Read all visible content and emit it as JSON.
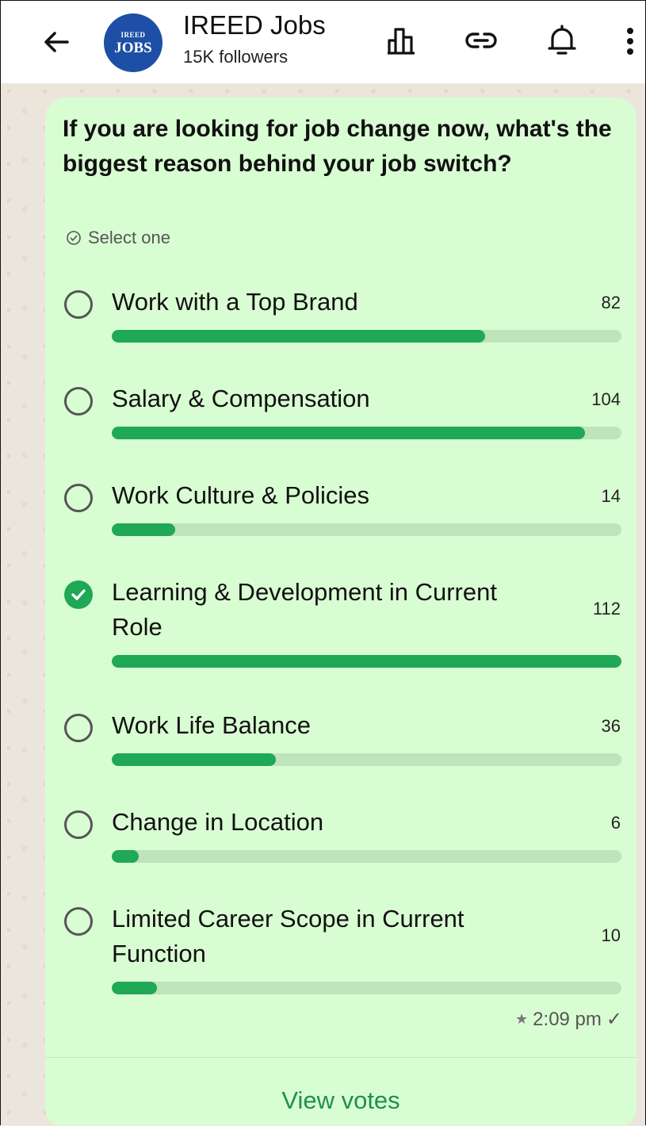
{
  "header": {
    "title": "IREED Jobs",
    "subtitle": "15K followers",
    "avatar_small": "IREED",
    "avatar_big": "JOBS",
    "icons": [
      "back-arrow-icon",
      "poll-icon",
      "link-icon",
      "bell-icon",
      "more-vert-icon"
    ]
  },
  "poll": {
    "question": "If you are looking for job change now, what's the biggest reason behind your job switch?",
    "select_hint": "Select one",
    "max_votes": 112,
    "options": [
      {
        "label": "Work with a Top Brand",
        "votes": "82",
        "value": 82,
        "selected": false
      },
      {
        "label": "Salary & Compensation",
        "votes": "104",
        "value": 104,
        "selected": false
      },
      {
        "label": "Work Culture & Policies",
        "votes": "14",
        "value": 14,
        "selected": false
      },
      {
        "label": "Learning & Development in Current Role",
        "votes": "112",
        "value": 112,
        "selected": true
      },
      {
        "label": "Work Life Balance",
        "votes": "36",
        "value": 36,
        "selected": false
      },
      {
        "label": "Change in Location",
        "votes": "6",
        "value": 6,
        "selected": false
      },
      {
        "label": "Limited Career Scope in Current Function",
        "votes": "10",
        "value": 10,
        "selected": false
      }
    ],
    "time": "2:09 pm",
    "view_votes": "View votes"
  },
  "colors": {
    "card": "#d9fdd3",
    "bar_fill": "#1fa855",
    "bar_track": "#bfe3bb",
    "link_green": "#1f8f4e"
  }
}
